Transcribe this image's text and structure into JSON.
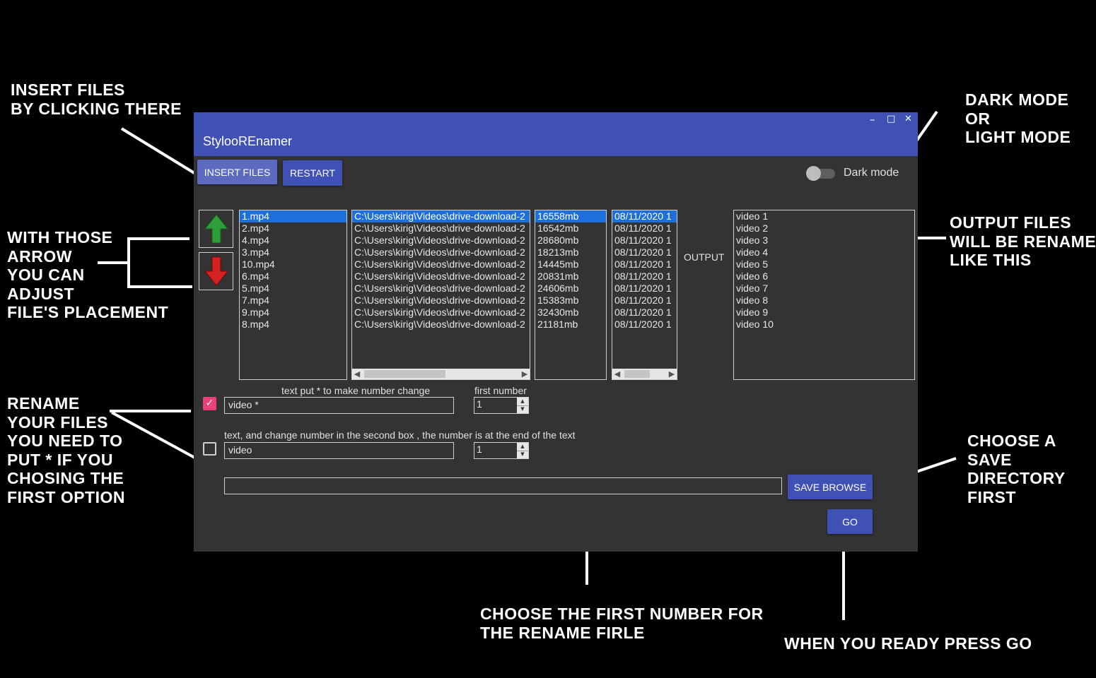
{
  "window": {
    "title": "StylooREnamer",
    "controls": {
      "minimize": "–",
      "maximize": "□",
      "close": "✕"
    }
  },
  "toolbar": {
    "insert_label": "INSERT FILES",
    "restart_label": "RESTART",
    "dark_mode_label": "Dark mode",
    "dark_mode_on": false
  },
  "files": {
    "names": [
      "1.mp4",
      "2.mp4",
      "4.mp4",
      "3.mp4",
      "10.mp4",
      "6.mp4",
      "5.mp4",
      "7.mp4",
      "9.mp4",
      "8.mp4"
    ],
    "paths": [
      "C:\\Users\\kirig\\Videos\\drive-download-2",
      "C:\\Users\\kirig\\Videos\\drive-download-2",
      "C:\\Users\\kirig\\Videos\\drive-download-2",
      "C:\\Users\\kirig\\Videos\\drive-download-2",
      "C:\\Users\\kirig\\Videos\\drive-download-2",
      "C:\\Users\\kirig\\Videos\\drive-download-2",
      "C:\\Users\\kirig\\Videos\\drive-download-2",
      "C:\\Users\\kirig\\Videos\\drive-download-2",
      "C:\\Users\\kirig\\Videos\\drive-download-2",
      "C:\\Users\\kirig\\Videos\\drive-download-2"
    ],
    "sizes": [
      "16558mb",
      "16542mb",
      "28680mb",
      "18213mb",
      "14445mb",
      "20831mb",
      "24606mb",
      "15383mb",
      "32430mb",
      "21181mb"
    ],
    "dates": [
      "08/11/2020 1",
      "08/11/2020 1",
      "08/11/2020 1",
      "08/11/2020 1",
      "08/11/2020 1",
      "08/11/2020 1",
      "08/11/2020 1",
      "08/11/2020 1",
      "08/11/2020 1",
      "08/11/2020 1"
    ],
    "selected_index": 0
  },
  "output": {
    "label": "OUTPUT",
    "names": [
      "video 1",
      "video 2",
      "video 3",
      "video 4",
      "video 5",
      "video 6",
      "video 7",
      "video 8",
      "video 9",
      "video 10"
    ]
  },
  "rename": {
    "option1_label": "text put * to make number change",
    "first_number_label": "first number",
    "option1_text": "video *",
    "option1_number": "1",
    "option1_checked": true,
    "option2_label": "text, and change number in the second box , the number is at the end of the text",
    "option2_text": "video",
    "option2_number": "1",
    "option2_checked": false
  },
  "save": {
    "path_value": "",
    "browse_label": "SAVE BROWSE"
  },
  "go_label": "GO",
  "annotations": {
    "insert": "Insert files\nby clicking there",
    "darkmode": "Dark mode\nor\nlight mode",
    "arrows": "With those\narrow\nyou can\nadjust\nfile's placement",
    "output": "Output files\nwill be renamed\nlike this",
    "rename": "Rename\nyour files\nyou need to\nput * if you\nchosing the\nfirst option",
    "savedir": "Choose a\nsave\ndirectory\nfirst",
    "firstnum": "Choose the first number for\nthe rename firle",
    "go": "When you ready press GO"
  },
  "colors": {
    "accent": "#3f51b5",
    "selection": "#1e6fd9",
    "checkbox_on": "#ec407a",
    "arrow_up": "#2e9e3a",
    "arrow_down": "#d32222"
  }
}
